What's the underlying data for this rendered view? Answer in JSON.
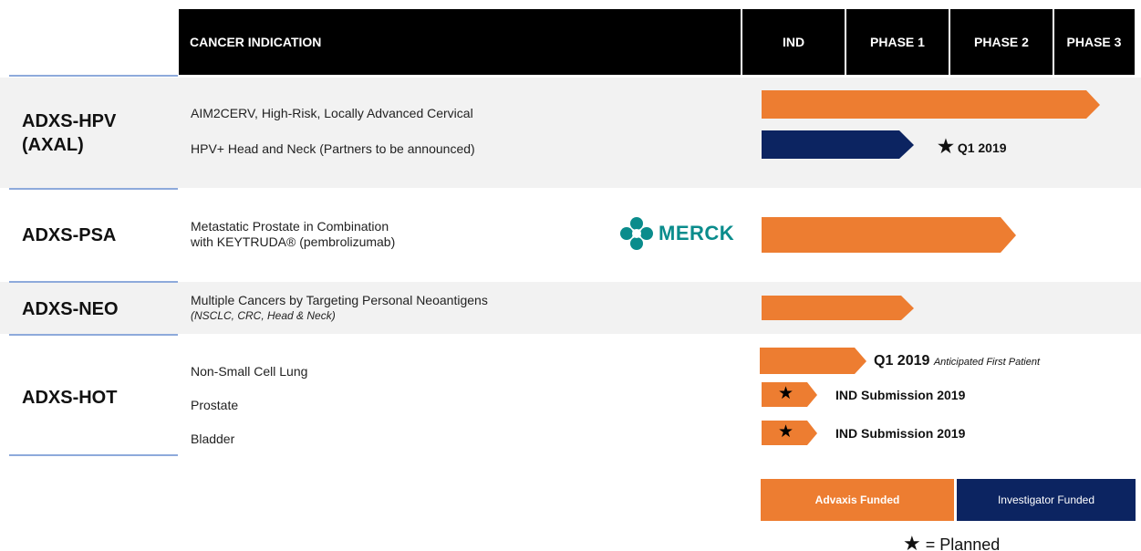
{
  "header": {
    "indication_label": "CANCER INDICATION",
    "phases": [
      "IND",
      "PHASE 1",
      "PHASE 2",
      "PHASE 3"
    ]
  },
  "programs": [
    {
      "name_line1": "ADXS-HPV",
      "name_line2": "(AXAL)",
      "indications": [
        {
          "label": "AIM2CERV, High-Risk, Locally Advanced Cervical",
          "stage": "Phase 3",
          "funding": "Advaxis Funded"
        },
        {
          "label": "HPV+ Head and Neck (Partners to be announced)",
          "stage": "Phase 1",
          "funding": "Investigator Funded",
          "note": "Q1 2019",
          "note_marker": "planned"
        }
      ]
    },
    {
      "name_line1": "ADXS-PSA",
      "indications": [
        {
          "label_line1": "Metastatic Prostate in Combination",
          "label_line2": "with KEYTRUDA® (pembrolizumab)",
          "stage": "Phase 2",
          "funding": "Advaxis Funded",
          "partner": "MERCK"
        }
      ]
    },
    {
      "name_line1": "ADXS-NEO",
      "indications": [
        {
          "label_line1": "Multiple Cancers by Targeting Personal Neoantigens",
          "label_line2": "(NSCLC, CRC, Head & Neck)",
          "stage": "Phase 1",
          "funding": "Advaxis Funded"
        }
      ]
    },
    {
      "name_line1": "ADXS-HOT",
      "indications": [
        {
          "label": "Non-Small Cell Lung",
          "stage": "IND",
          "funding": "Advaxis Funded",
          "note": "Q1 2019",
          "note_detail": "Anticipated First Patient"
        },
        {
          "label": "Prostate",
          "stage": "IND",
          "funding": "Advaxis Funded",
          "note": "IND Submission 2019",
          "note_marker": "planned"
        },
        {
          "label": "Bladder",
          "stage": "IND",
          "funding": "Advaxis Funded",
          "note": "IND Submission 2019",
          "note_marker": "planned"
        }
      ]
    }
  ],
  "legend": {
    "advaxis": "Advaxis Funded",
    "investigator": "Investigator Funded",
    "planned_label": "= Planned"
  },
  "colors": {
    "advaxis": "#ed7d31",
    "investigator": "#0c2461",
    "header": "#000000",
    "band": "#f2f2f2",
    "merck": "#0a8c8c"
  }
}
